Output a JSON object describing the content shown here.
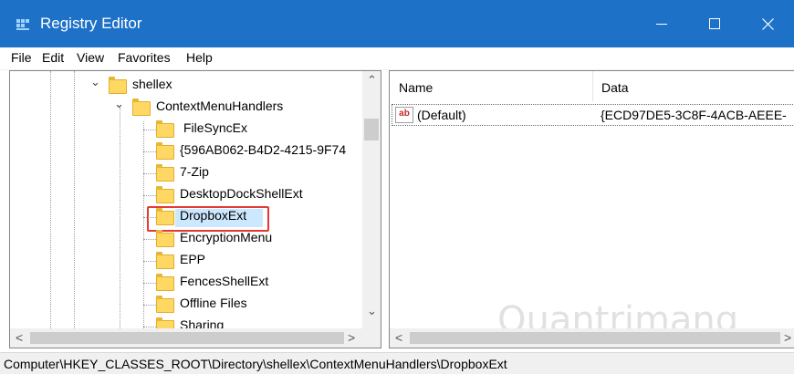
{
  "window": {
    "title": "Registry Editor",
    "controls": {
      "minimize": "—",
      "maximize": "☐",
      "close": "✕"
    }
  },
  "menu": {
    "items": [
      {
        "label": "File"
      },
      {
        "label": "Edit"
      },
      {
        "label": "View"
      },
      {
        "label": "Favorites"
      },
      {
        "label": "Help"
      }
    ]
  },
  "tree": {
    "nodes": [
      {
        "label": "shellex",
        "expanded": true
      },
      {
        "label": "ContextMenuHandlers",
        "expanded": true
      },
      {
        "label": "FileSyncEx"
      },
      {
        "label": "{596AB062-B4D2-4215-9F74"
      },
      {
        "label": "7-Zip"
      },
      {
        "label": "DesktopDockShellExt"
      },
      {
        "label": "DropboxExt",
        "selected": true
      },
      {
        "label": "EncryptionMenu"
      },
      {
        "label": "EPP"
      },
      {
        "label": "FencesShellExt"
      },
      {
        "label": "Offline Files"
      },
      {
        "label": "Sharing"
      }
    ],
    "scroll_up": "⌃",
    "scroll_down": "⌄",
    "scroll_left": "<",
    "scroll_right": ">"
  },
  "list": {
    "columns": [
      {
        "label": "Name"
      },
      {
        "label": "Data"
      }
    ],
    "rows": [
      {
        "icon": "string-value-icon",
        "icon_text": "ab",
        "name": "(Default)",
        "data": "{ECD97DE5-3C8F-4ACB-AEEE-"
      }
    ],
    "scroll_left": "<",
    "scroll_right": ">"
  },
  "status": {
    "path": "Computer\\HKEY_CLASSES_ROOT\\Directory\\shellex\\ContextMenuHandlers\\DropboxExt"
  },
  "watermark": {
    "text": "Quantrimang"
  },
  "colors": {
    "titlebar": "#1d71c7",
    "highlight": "#cce8ff",
    "selection_outline": "#e53935"
  }
}
